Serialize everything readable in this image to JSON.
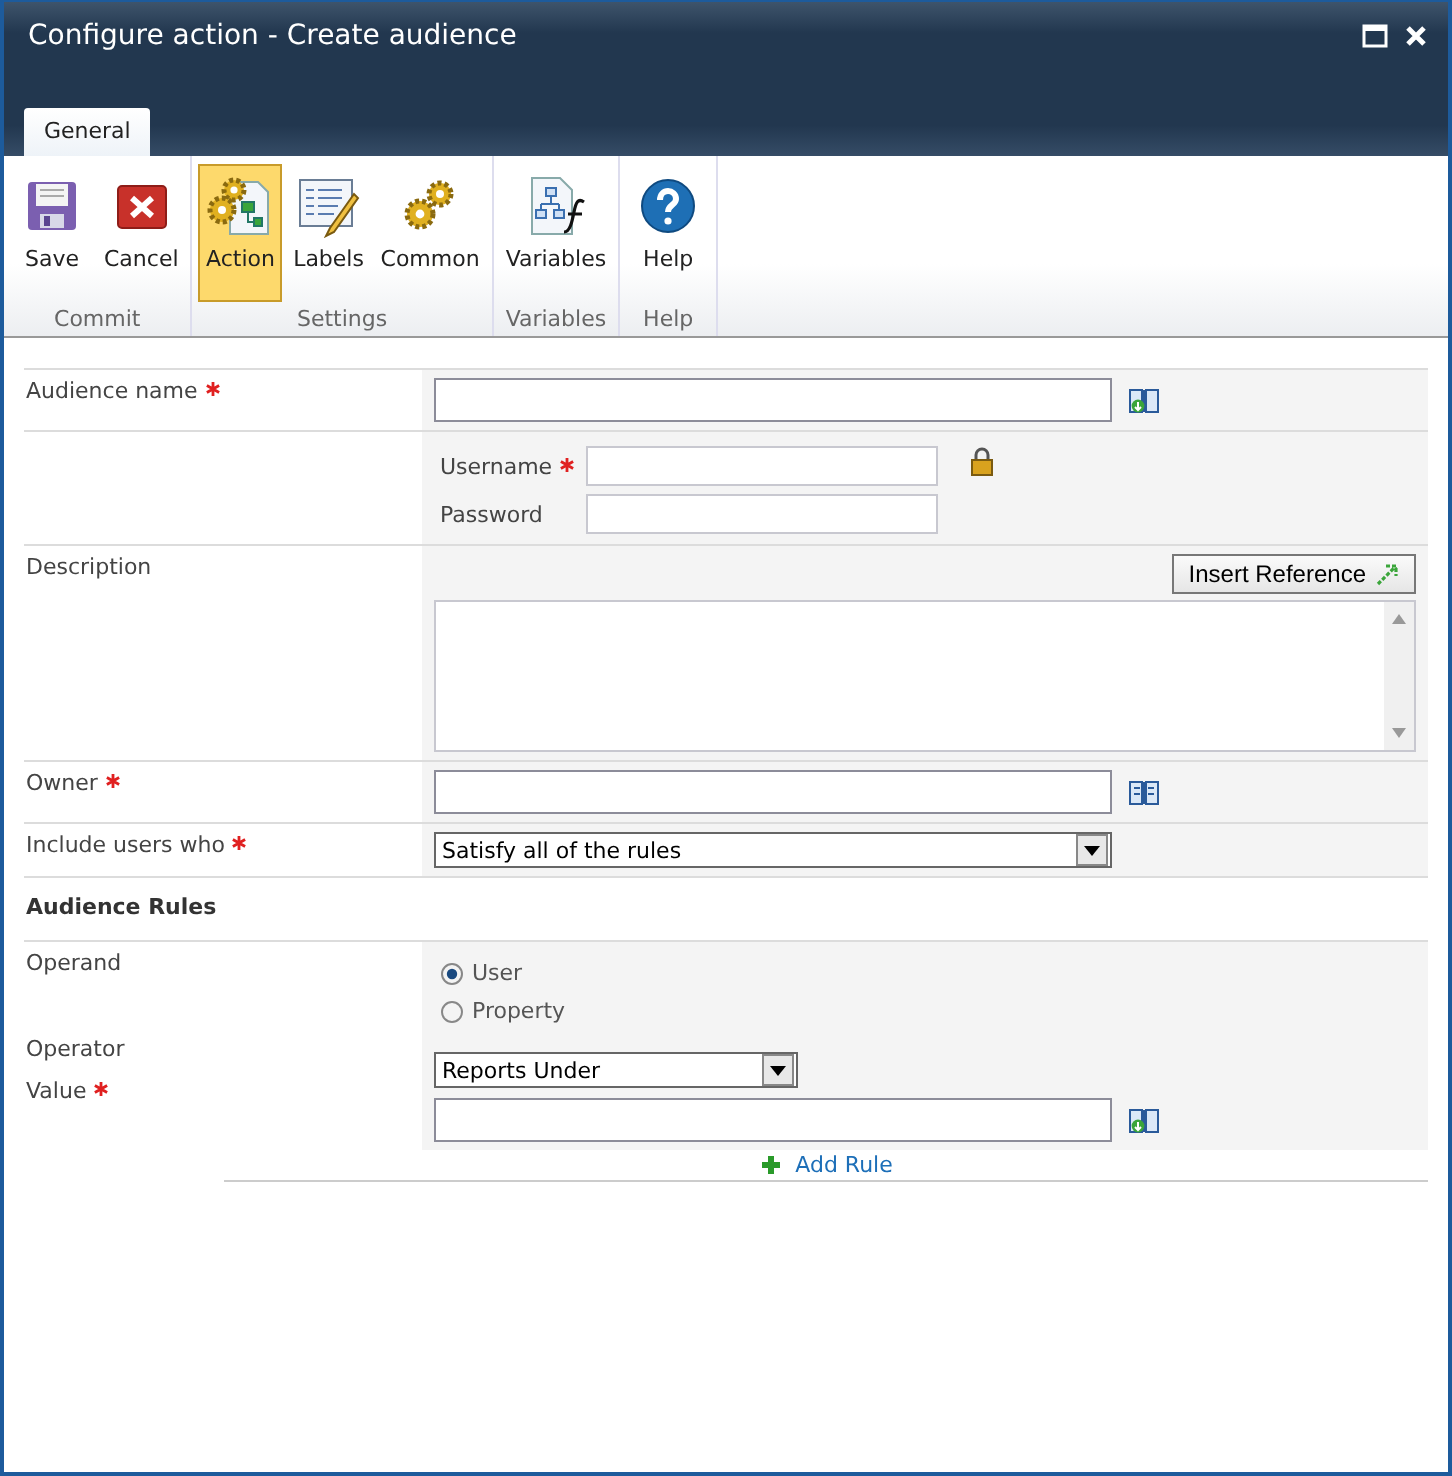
{
  "window": {
    "title": "Configure action - Create audience"
  },
  "tabs": [
    {
      "label": "General",
      "selected": true
    }
  ],
  "ribbon": {
    "groups": [
      {
        "label": "Commit",
        "buttons": [
          {
            "label": "Save",
            "kind": "save",
            "selected": false
          },
          {
            "label": "Cancel",
            "kind": "cancel",
            "selected": false
          }
        ]
      },
      {
        "label": "Settings",
        "buttons": [
          {
            "label": "Action",
            "kind": "action",
            "selected": true
          },
          {
            "label": "Labels",
            "kind": "labels",
            "selected": false
          },
          {
            "label": "Common",
            "kind": "common",
            "selected": false
          }
        ]
      },
      {
        "label": "Variables",
        "buttons": [
          {
            "label": "Variables",
            "kind": "variables",
            "selected": false
          }
        ]
      },
      {
        "label": "Help",
        "buttons": [
          {
            "label": "Help",
            "kind": "help",
            "selected": false
          }
        ]
      }
    ]
  },
  "form": {
    "rows": [
      {
        "kind": "text",
        "label": "Audience name",
        "required": true
      },
      {
        "kind": "credentials",
        "fields": [
          {
            "label": "Username",
            "required": true
          },
          {
            "label": "Password",
            "required": false
          }
        ]
      },
      {
        "kind": "textarea",
        "label": "Description",
        "button": "Insert Reference"
      },
      {
        "kind": "text",
        "label": "Owner",
        "required": true
      },
      {
        "kind": "select",
        "label": "Include users who",
        "required": true,
        "value": "Satisfy all of the rules"
      }
    ]
  },
  "rules": {
    "heading": "Audience Rules",
    "operand_label": "Operand",
    "operands": [
      {
        "label": "User",
        "selected": true
      },
      {
        "label": "Property",
        "selected": false
      }
    ],
    "operator_label": "Operator",
    "operator": "Reports Under",
    "value_label": "Value",
    "value_required": true,
    "add_rule": "Add Rule"
  }
}
